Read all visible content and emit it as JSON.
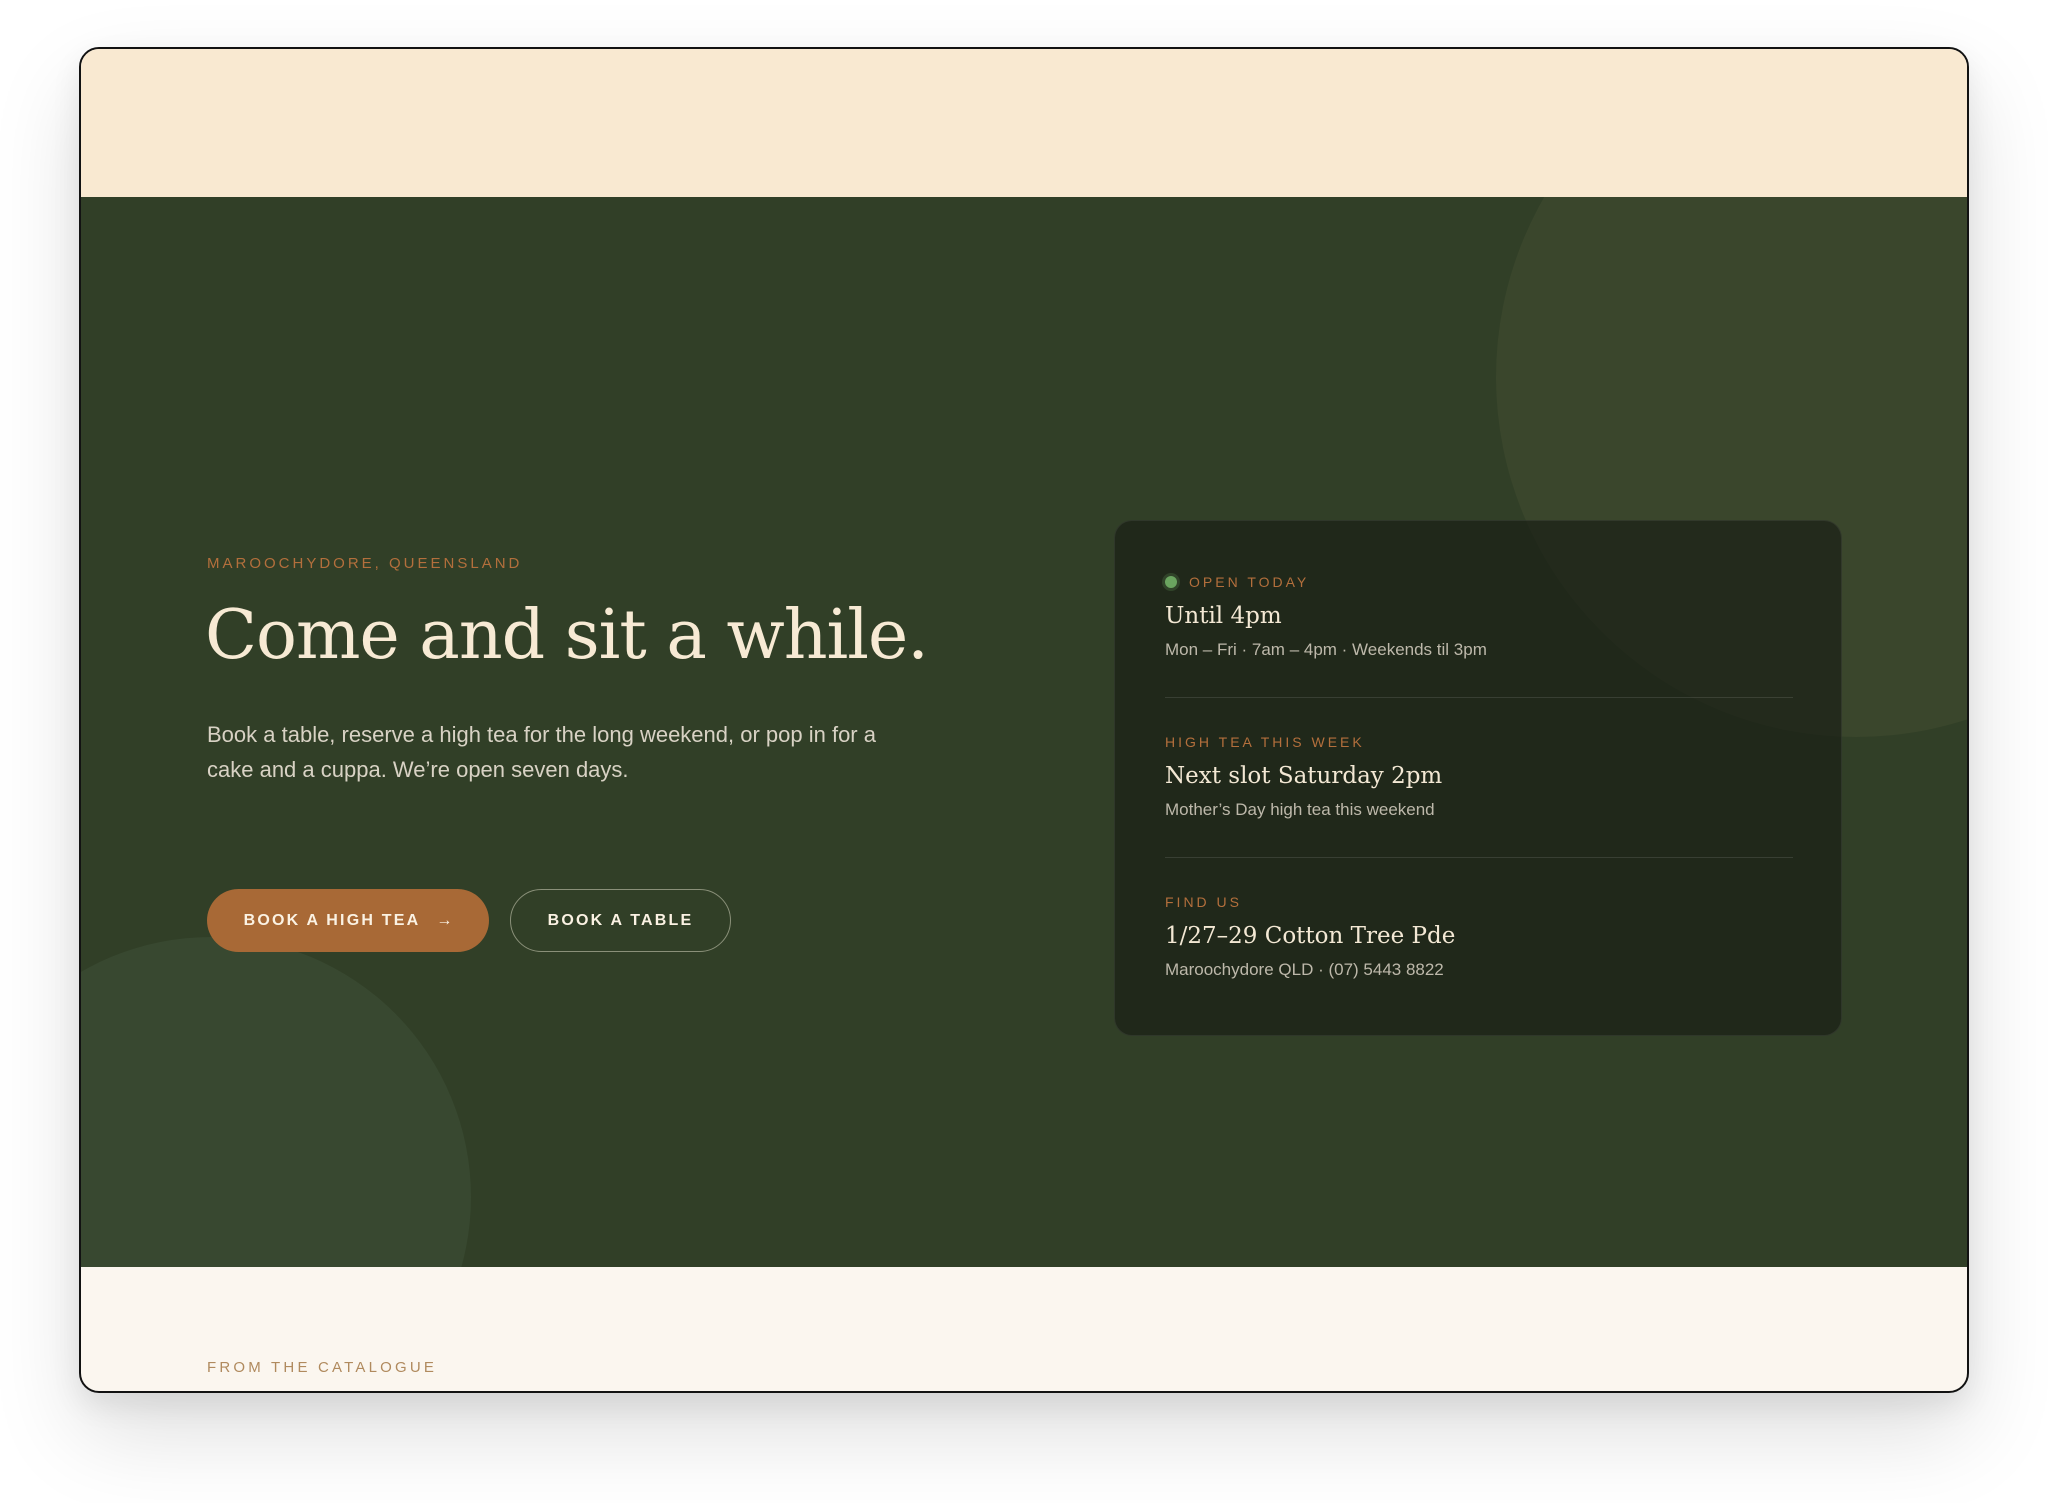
{
  "hero": {
    "eyebrow": "MAROOCHYDORE, QUEENSLAND",
    "headline": "Come and sit a while.",
    "lede": "Book a table, reserve a high tea for the long weekend, or pop in for a cake and a cuppa. We’re open seven days.",
    "primary_button": "BOOK A HIGH TEA",
    "primary_button_icon": "→",
    "secondary_button": "BOOK A TABLE"
  },
  "info_card": {
    "hours": {
      "label": "OPEN TODAY",
      "title": "Until 4pm",
      "detail": "Mon – Fri · 7am – 4pm · Weekends til 3pm"
    },
    "high_tea": {
      "label": "HIGH TEA THIS WEEK",
      "title": "Next slot Saturday 2pm",
      "detail": "Mother’s Day high tea this weekend"
    },
    "location": {
      "label": "FIND US",
      "title": "1/27–29 Cotton Tree Pde",
      "detail": "Maroochydore QLD · (07) 5443 8822"
    }
  },
  "catalogue": {
    "eyebrow": "FROM THE CATALOGUE"
  },
  "colors": {
    "top_band": "#f9e9d1",
    "hero_bg": "#313f27",
    "accent": "#a86936",
    "cream_text": "#f7ead4",
    "status_open": "#6aa45f",
    "page_bg": "#fbf6ef"
  }
}
